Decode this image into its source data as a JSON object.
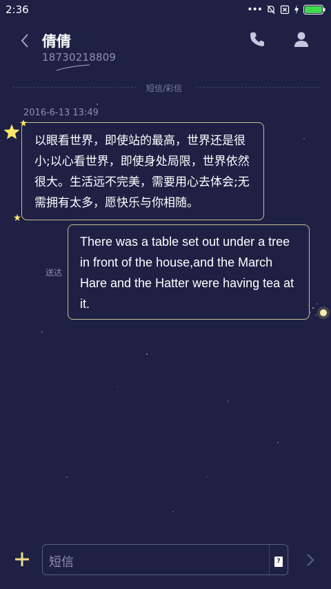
{
  "status_bar": {
    "time": "2:36",
    "icons": [
      "more-dots-icon",
      "mute-bell-icon",
      "sim-error-icon",
      "charging-icon",
      "battery-icon"
    ],
    "battery_color": "#3ddc4a"
  },
  "header": {
    "contact_name": "倩倩",
    "contact_number": "18730218809"
  },
  "conversation": {
    "message_type_label": "短信/彩信",
    "timestamp": "2016-6-13 13:49",
    "incoming_message": "以眼看世界，即使站的最高，世界还是很小;以心看世界，即使身处局限，世界依然很大。生活远不完美，需要用心去体会;无需拥有太多，愿快乐与你相随。",
    "outgoing_message": "There was a table set out under a tree in front of the house,and the March Hare and the Hatter were having tea at it.",
    "delivery_status": "送达"
  },
  "compose": {
    "placeholder": "短信",
    "sim_badge": "?"
  },
  "colors": {
    "background": "#1e2144",
    "bubble_border": "#c9c08e",
    "muted_text": "#8d90ae",
    "star_yellow": "#ffe86a"
  }
}
